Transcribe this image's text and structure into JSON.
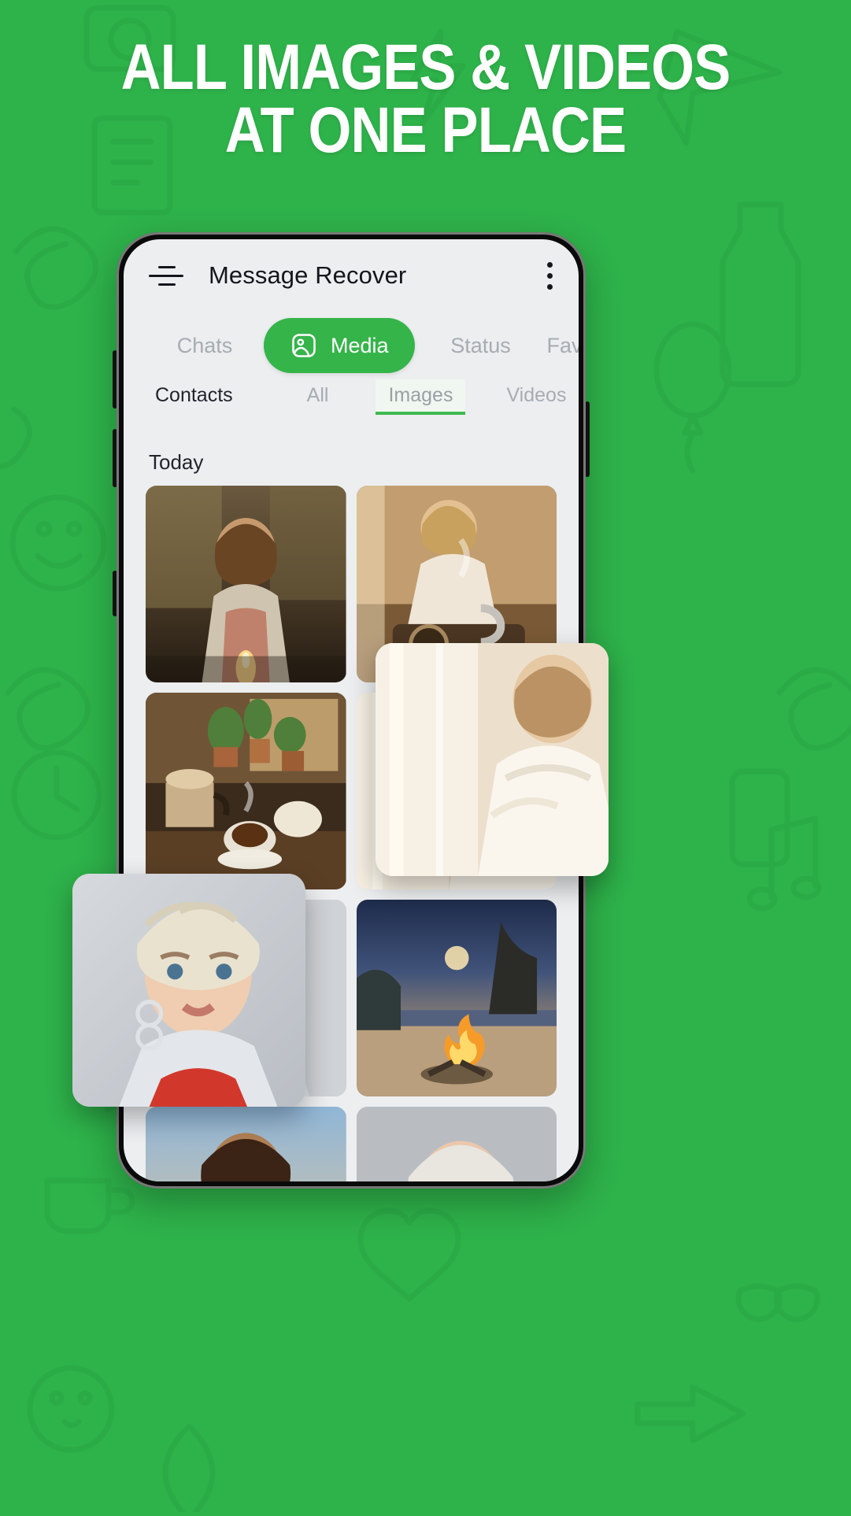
{
  "promo": {
    "headline_line1": "ALL IMAGES & VIDEOS",
    "headline_line2": "AT ONE PLACE",
    "background_color": "#2eb24a",
    "accent_color": "#35b44a"
  },
  "app": {
    "title": "Message Recover",
    "menu_icon": "hamburger-icon",
    "overflow_icon": "kebab-menu-icon",
    "tabs": [
      {
        "label": "Chats",
        "active": false
      },
      {
        "label": "Media",
        "active": true,
        "icon": "image-person-icon"
      },
      {
        "label": "Status",
        "active": false
      },
      {
        "label": "Favo",
        "active": false
      }
    ],
    "subtabs": [
      {
        "label": "Contacts",
        "active": false,
        "style": "dark"
      },
      {
        "label": "All",
        "active": false,
        "style": "muted"
      },
      {
        "label": "Images",
        "active": true,
        "style": "selected"
      },
      {
        "label": "Videos",
        "active": false,
        "style": "muted"
      }
    ],
    "section_header": "Today",
    "gallery": [
      {
        "name": "woman-meditating-with-candle",
        "row": 1,
        "col": 1
      },
      {
        "name": "woman-pouring-coffee-kitchen",
        "row": 1,
        "col": 2
      },
      {
        "name": "kettle-and-coffee-cups-window",
        "row": 2,
        "col": 1
      },
      {
        "name": "woman-resting-by-window",
        "row": 2,
        "col": 2
      },
      {
        "name": "woman-braided-hair-portrait",
        "row": 3,
        "col": 1
      },
      {
        "name": "bonfire-on-beach-at-dusk",
        "row": 3,
        "col": 2
      },
      {
        "name": "woman-curly-hair-sunset",
        "row": 4,
        "col": 1
      },
      {
        "name": "woman-silver-hair-portrait",
        "row": 4,
        "col": 2
      }
    ],
    "floating_cards": [
      {
        "name": "woman-resting-by-window-card"
      },
      {
        "name": "woman-braided-hair-card"
      }
    ]
  }
}
